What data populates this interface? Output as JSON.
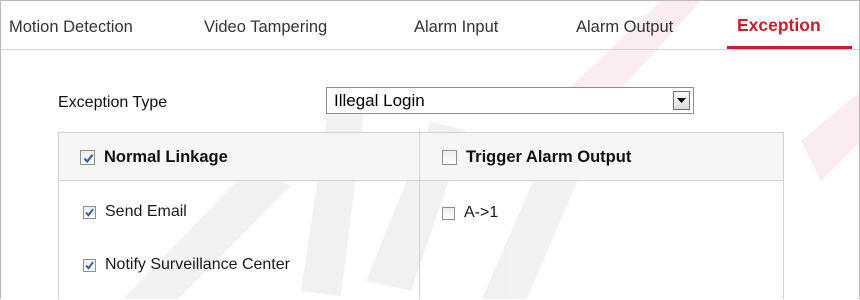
{
  "tabs": [
    {
      "label": "Motion Detection",
      "active": false
    },
    {
      "label": "Video Tampering",
      "active": false
    },
    {
      "label": "Alarm Input",
      "active": false
    },
    {
      "label": "Alarm Output",
      "active": false
    },
    {
      "label": "Exception",
      "active": true
    }
  ],
  "exception_type": {
    "label": "Exception Type",
    "selected": "Illegal Login"
  },
  "linkage": {
    "normal": {
      "label": "Normal Linkage",
      "checked": true,
      "items": [
        {
          "label": "Send Email",
          "checked": true
        },
        {
          "label": "Notify Surveillance Center",
          "checked": true
        }
      ]
    },
    "trigger": {
      "label": "Trigger Alarm Output",
      "checked": false,
      "items": [
        {
          "label": "A->1",
          "checked": false
        }
      ]
    }
  },
  "colors": {
    "accent": "#c81d2e",
    "header_bg": "#f6f6f6",
    "border": "#d2d2d2",
    "checkmark": "#3a5fa0"
  }
}
